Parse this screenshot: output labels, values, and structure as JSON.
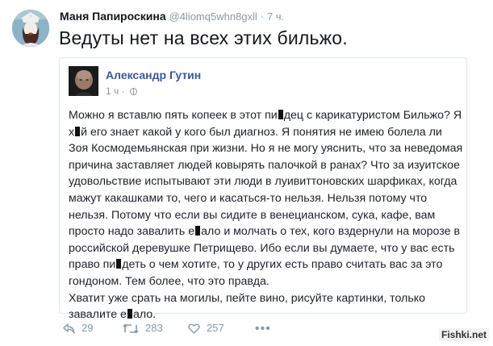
{
  "tweet": {
    "author_name": "Маня Папироскина",
    "author_handle": "@4liomq5whn8gxll",
    "dot": "·",
    "time": "7 ч.",
    "text": "Ведуты нет на всех этих бильжо."
  },
  "quoted_post": {
    "author_name": "Александр Гутин",
    "time": "1 ч",
    "body": {
      "p1": [
        "Можно я вставлю пять копеек в этот пи",
        "дец с карикатуристом Бильжо? Я х",
        "й его знает какой у кого был диагноз. Я понятия не имею болела ли Зоя Космодемьянская при жизни. Но я не могу уяснить, что за неведомая причина заставляет людей ковырять палочкой в ранах? Что за изуитское удовольствие испытывают эти люди в луивиттоновских шарфиках, когда мажут какашками то, чего и касаться-то нельзя. Нельзя потому что нельзя. Потому что если вы сидите в венецианском, сука, кафе, вам просто надо завалить е",
        "ало и молчать о тех, кого вздернули на морозе в российской деревушке Петрищево. Ибо если вы думаете, что у вас есть право пи",
        "деть о чем хотите, то у других есть право считать вас за это гондоном. Тем более, что это правда."
      ],
      "p2": [
        "Хватит уже срать на могилы, пейте вино, рисуйте картинки, только завалите е",
        "ало."
      ]
    }
  },
  "actions": {
    "reply_count": "29",
    "retweet_count": "283",
    "like_count": "257",
    "more": "•••"
  },
  "watermark": "Fishki.net",
  "colors": {
    "link_blue": "#3b5998",
    "muted": "#8899a6",
    "text": "#14171a"
  }
}
